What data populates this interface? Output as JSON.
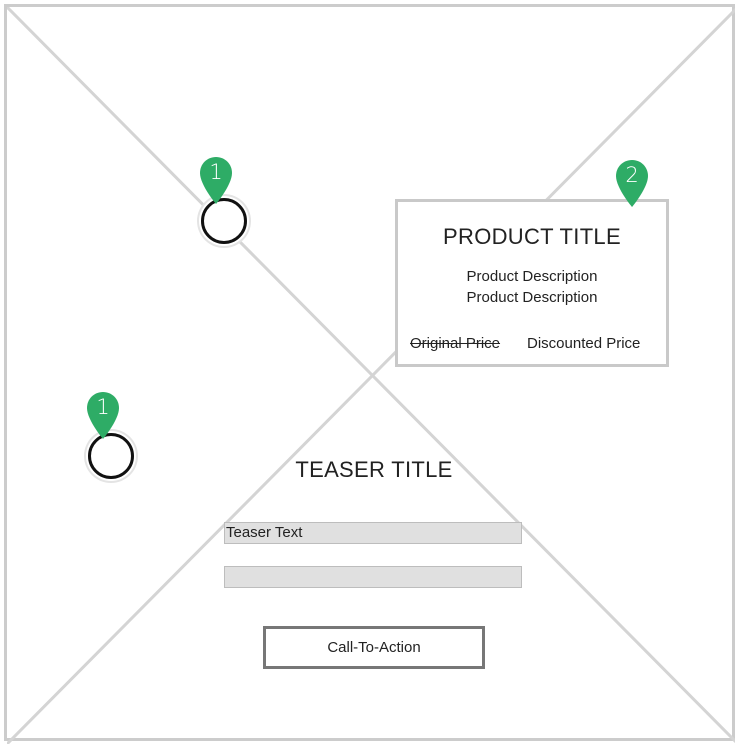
{
  "hotspots": [
    {
      "label": "1"
    },
    {
      "label": "1"
    },
    {
      "label": "2"
    }
  ],
  "product": {
    "title": "PRODUCT TITLE",
    "description_line_1": "Product Description",
    "description_line_2": "Product Description",
    "original_price": "Original Price",
    "discounted_price": "Discounted Price"
  },
  "teaser": {
    "title": "TEASER TITLE",
    "text": "Teaser Text",
    "cta_label": "Call-To-Action"
  },
  "colors": {
    "pin_green": "#2eac66",
    "frame_border": "#cccccc",
    "placeholder_line": "#d4d4d4",
    "bar_fill": "#e0e0e0"
  },
  "icons": {
    "pin": "map-pin-icon",
    "hotspot": "hotspot-ring-icon"
  }
}
